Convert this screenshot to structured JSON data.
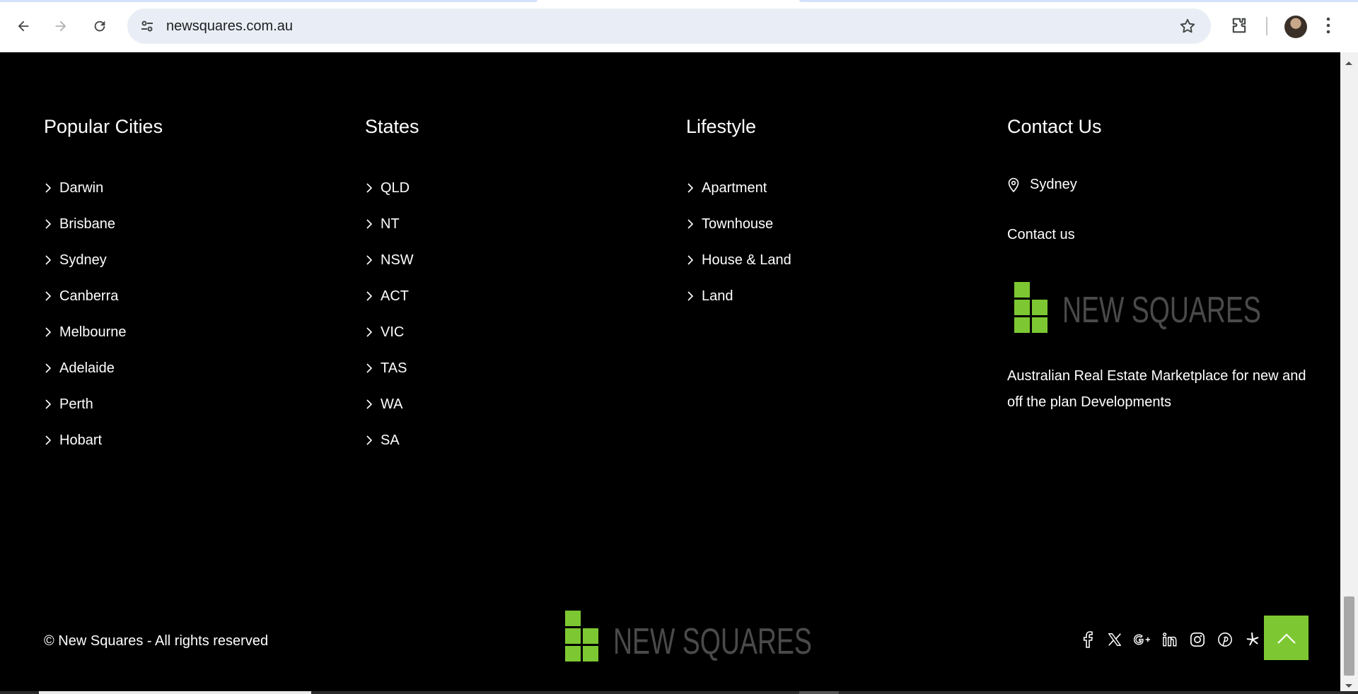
{
  "browser": {
    "url": "newsquares.com.au"
  },
  "footer": {
    "columns": [
      {
        "title": "Popular Cities",
        "links": [
          "Darwin",
          "Brisbane",
          "Sydney",
          "Canberra",
          "Melbourne",
          "Adelaide",
          "Perth",
          "Hobart"
        ]
      },
      {
        "title": "States",
        "links": [
          "QLD",
          "NT",
          "NSW",
          "ACT",
          "VIC",
          "TAS",
          "WA",
          "SA"
        ]
      },
      {
        "title": "Lifestyle",
        "links": [
          "Apartment",
          "Townhouse",
          "House & Land",
          "Land"
        ]
      }
    ],
    "contact": {
      "title": "Contact Us",
      "location": "Sydney",
      "contact_link": "Contact us",
      "logo_text": "NEW SQUARES",
      "tagline": "Australian Real Estate Marketplace for new and off the plan Developments"
    },
    "bottom": {
      "copyright": "© New Squares - All rights reserved",
      "logo_text": "NEW SQUARES",
      "social_icons": [
        "facebook-icon",
        "x-twitter-icon",
        "google-plus-icon",
        "linkedin-icon",
        "instagram-icon",
        "pinterest-icon",
        "yelp-icon"
      ]
    }
  },
  "colors": {
    "brand_green": "#7dc832",
    "logo_gray": "#4a4a4a",
    "background": "#000000"
  }
}
